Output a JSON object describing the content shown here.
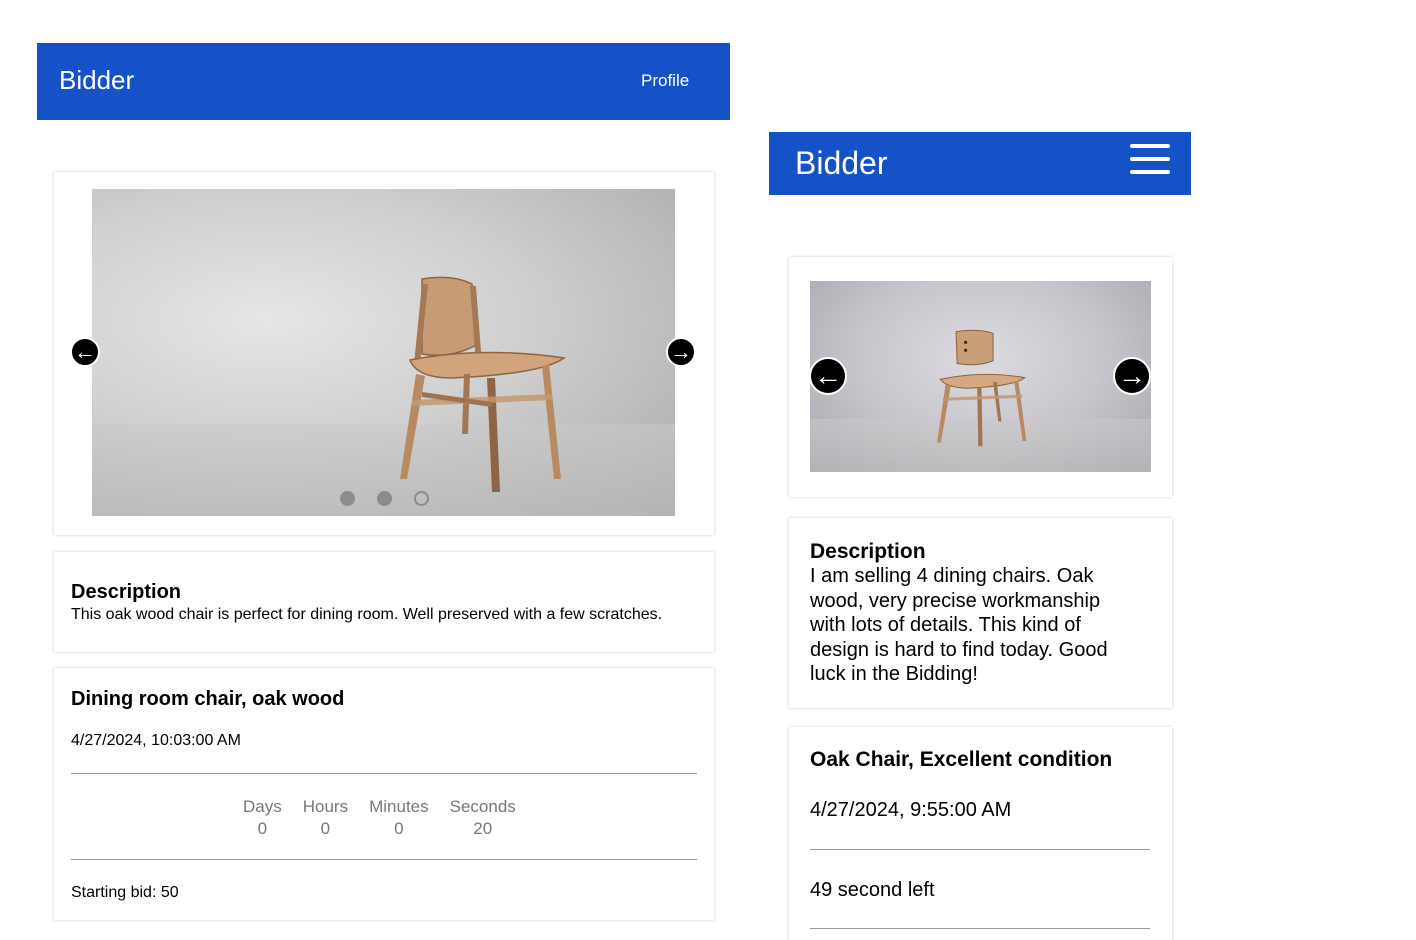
{
  "desktop": {
    "header": {
      "brand": "Bidder",
      "profile_label": "Profile"
    },
    "carousel": {
      "prev_icon": "arrow-left-icon",
      "next_icon": "arrow-right-icon",
      "slide_count": 3,
      "active_index": 2
    },
    "description": {
      "title": "Description",
      "text": "This oak wood chair is perfect for dining room. Well preserved with a few scratches."
    },
    "item": {
      "title": "Dining room chair, oak wood",
      "date": "4/27/2024, 10:03:00 AM",
      "countdown": {
        "labels": [
          "Days",
          "Hours",
          "Minutes",
          "Seconds"
        ],
        "values": [
          "0",
          "0",
          "0",
          "20"
        ]
      },
      "starting_bid": "Starting bid: 50"
    }
  },
  "mobile": {
    "header": {
      "brand": "Bidder",
      "menu_icon": "hamburger-menu-icon"
    },
    "description": {
      "title": "Description",
      "text": "I am selling 4 dining chairs. Oak wood, very precise workmanship with lots of details. This kind of design is hard to find today. Good luck in the Bidding!"
    },
    "item": {
      "title": "Oak Chair, Excellent condition",
      "date": "4/27/2024, 9:55:00 AM",
      "time_left": "49 second left"
    }
  },
  "colors": {
    "header_blue": "#1552c8",
    "countdown_gray": "#777777",
    "dot_gray": "#8c8c8c"
  }
}
